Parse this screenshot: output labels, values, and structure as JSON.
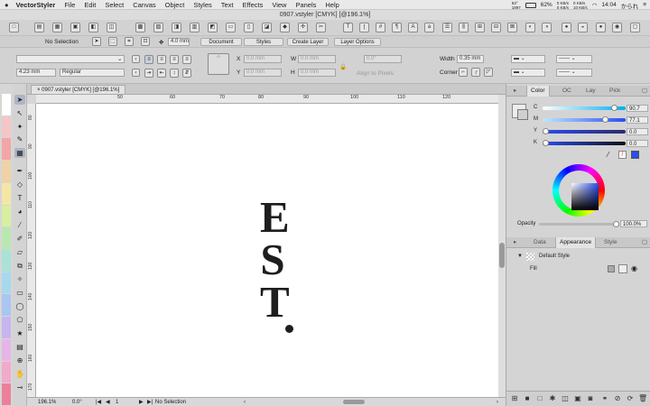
{
  "menubar": {
    "app": "VectorStyler",
    "items": [
      "File",
      "Edit",
      "Select",
      "Canvas",
      "Object",
      "Styles",
      "Text",
      "Effects",
      "View",
      "Panels",
      "Help"
    ],
    "cpu": "63°\n1897",
    "battery": "62%",
    "net1": "0 KB/s\n0 KB/s",
    "net2": "0 KB/s\n10 KB/s",
    "time": "14:04",
    "user": "かられ"
  },
  "window": {
    "title": "0907.vstyler [CMYK] [@196.1%]"
  },
  "toolbar2": {
    "selection": "No Selection",
    "size": "4.0 mm",
    "document": "Document",
    "styles": "Styles",
    "create_layer": "Create Layer",
    "layer_options": "Layer Options"
  },
  "toolbar3": {
    "font_size": "4.23 mm",
    "font_style": "Regular",
    "x": "0.0 mm",
    "y": "0.0 mm",
    "w": "0.0 mm",
    "h": "0.0 mm",
    "angle": "0.0°",
    "align_pixels": "Align to Pixels",
    "width_label": "Width",
    "width_value": "0.35 mm",
    "corner_label": "Corner"
  },
  "doc_tab": "0907.vstyler [CMYK] [@196.1%]",
  "ruler_h": [
    "50",
    "60",
    "70",
    "80",
    "90",
    "100",
    "110",
    "120"
  ],
  "ruler_v": [
    "80",
    "90",
    "100",
    "110",
    "120",
    "130",
    "140",
    "150",
    "160",
    "170"
  ],
  "artwork": {
    "letters": [
      "E",
      "S",
      "T"
    ]
  },
  "status": {
    "zoom": "196.1%",
    "angle": "0.0°",
    "page": "1",
    "selection": "No Selection"
  },
  "color_panel": {
    "tabs": [
      "Color",
      "OC",
      "Lay",
      "Pick"
    ],
    "channels": [
      {
        "label": "C",
        "value": "90.7"
      },
      {
        "label": "M",
        "value": "77.1"
      },
      {
        "label": "Y",
        "value": "0.0"
      },
      {
        "label": "K",
        "value": "0.0"
      }
    ],
    "opacity_label": "Opacity",
    "opacity_value": "100.0%"
  },
  "appearance_panel": {
    "tabs": [
      "Data",
      "Appearance",
      "Style"
    ],
    "default_style": "Default Style",
    "fill": "Fill"
  },
  "colors": {
    "accent": "#2a4df0",
    "swatches": [
      "#ffffff",
      "#f5c6c6",
      "#f4a6a6",
      "#f1d1a6",
      "#f5e7a3",
      "#d8efa1",
      "#b7e8b0",
      "#a9e3d6",
      "#a6d8ef",
      "#a9c6f1",
      "#c6b5f0",
      "#e8b4e8",
      "#f3a9c9",
      "#ee7f9b"
    ]
  }
}
